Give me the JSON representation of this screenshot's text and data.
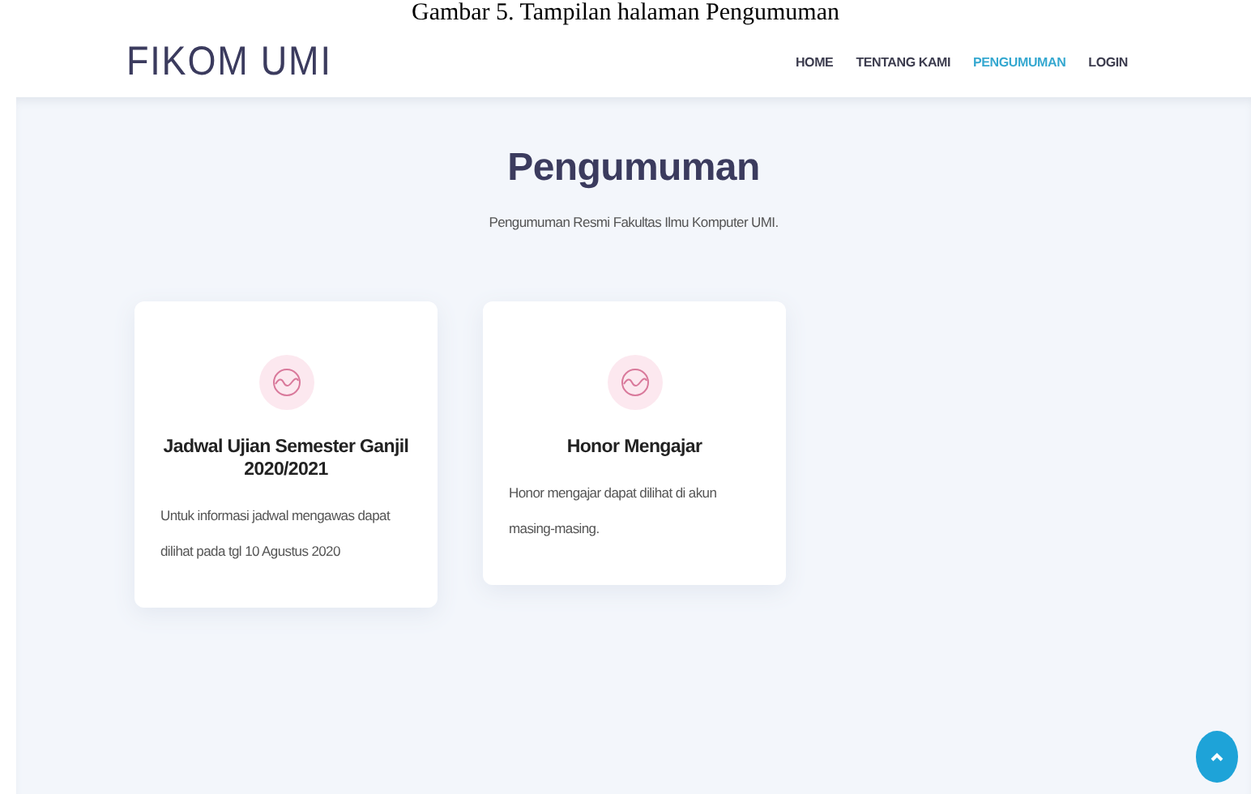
{
  "caption": "Gambar 5. Tampilan halaman Pengumuman",
  "header": {
    "brand": "FIKOM UMI",
    "nav": [
      {
        "label": "HOME",
        "selected": false
      },
      {
        "label": "TENTANG KAMI",
        "selected": false
      },
      {
        "label": "PENGUMUMAN",
        "selected": true
      },
      {
        "label": "LOGIN",
        "selected": false
      }
    ]
  },
  "section": {
    "title": "Pengumuman",
    "subtitle": "Pengumuman Resmi Fakultas Ilmu Komputer UMI.",
    "cards": [
      {
        "title": "Jadwal Ujian Semester Ganjil 2020/2021",
        "text": "Untuk informasi jadwal mengawas dapat dilihat pada tgl 10 Agustus 2020"
      },
      {
        "title": "Honor Mengajar",
        "text": "Honor mengajar dapat dilihat di akun masing-masing."
      }
    ]
  }
}
